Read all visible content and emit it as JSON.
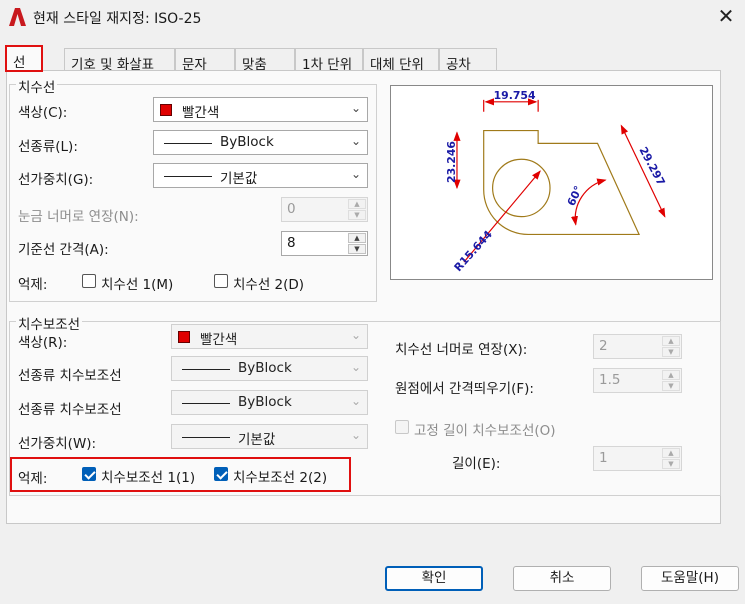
{
  "window": {
    "title": "현재 스타일 재지정: ISO-25",
    "close": "✕"
  },
  "tabs": [
    "선",
    "기호 및 화살표",
    "문자",
    "맞춤",
    "1차 단위",
    "대체 단위",
    "공차"
  ],
  "dim_lines": {
    "legend": "치수선",
    "color_label": "색상(C):",
    "color_value": "빨간색",
    "linetype_label": "선종류(L):",
    "linetype_value": "ByBlock",
    "lineweight_label": "선가중치(G):",
    "lineweight_value": "기본값",
    "extend_label": "눈금 너머로 연장(N):",
    "extend_value": "0",
    "baseline_label": "기준선 간격(A):",
    "baseline_value": "8",
    "suppress_label": "억제:",
    "suppress1": "치수선 1(M)",
    "suppress2": "치수선 2(D)"
  },
  "ext_lines": {
    "legend": "치수보조선",
    "color_label": "색상(R):",
    "color_value": "빨간색",
    "linetype1_label": "선종류 치수보조선",
    "linetype1_value": "ByBlock",
    "linetype2_label": "선종류 치수보조선",
    "linetype2_value": "ByBlock",
    "lineweight_label": "선가중치(W):",
    "lineweight_value": "기본값",
    "suppress_label": "억제:",
    "suppress1": "치수보조선 1(1)",
    "suppress2": "치수보조선 2(2)",
    "extend_label": "치수선 너머로 연장(X):",
    "extend_value": "2",
    "offset_label": "원점에서 간격띄우기(F):",
    "offset_value": "1.5",
    "fixed_label": "고정 길이 치수보조선(O)",
    "length_label": "길이(E):",
    "length_value": "1"
  },
  "preview": {
    "dim_top": "19.754",
    "dim_left": "23.246",
    "dim_right": "29.297",
    "dim_angle": "60°",
    "dim_radius": "R15.644"
  },
  "buttons": {
    "ok": "확인",
    "cancel": "취소",
    "help": "도움말(H)"
  },
  "colors": {
    "accent": "#005fb8",
    "highlight": "#e01010",
    "swatch": "#e00000",
    "dim_blue": "#1a1aa6",
    "geom": "#a07a1a"
  }
}
